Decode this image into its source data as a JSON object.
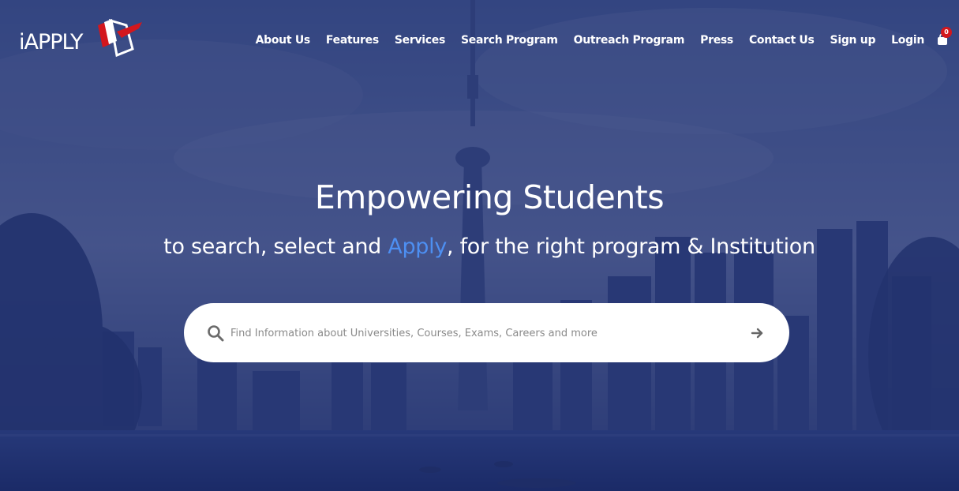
{
  "brand": {
    "logo_text": "APPLY",
    "logo_prefix": "i",
    "accent_color": "#d3171d"
  },
  "nav": {
    "items": [
      {
        "label": "About Us"
      },
      {
        "label": "Features"
      },
      {
        "label": "Services"
      },
      {
        "label": "Search Program"
      },
      {
        "label": "Outreach Program"
      },
      {
        "label": "Press"
      },
      {
        "label": "Contact Us"
      },
      {
        "label": "Sign up"
      },
      {
        "label": "Login"
      }
    ]
  },
  "cart": {
    "count": "0",
    "icon": "user-cart-icon"
  },
  "hero": {
    "headline": "Empowering Students",
    "sub_before": "to search, select and ",
    "sub_accent": "Apply",
    "sub_after": ", for the right program & Institution",
    "accent_color": "#4d8ff2",
    "background": "city-skyline-photo"
  },
  "search": {
    "placeholder": "Find Information about Universities, Courses, Exams, Careers and more",
    "value": "",
    "search_icon": "search-icon",
    "submit_icon": "arrow-right-icon"
  }
}
